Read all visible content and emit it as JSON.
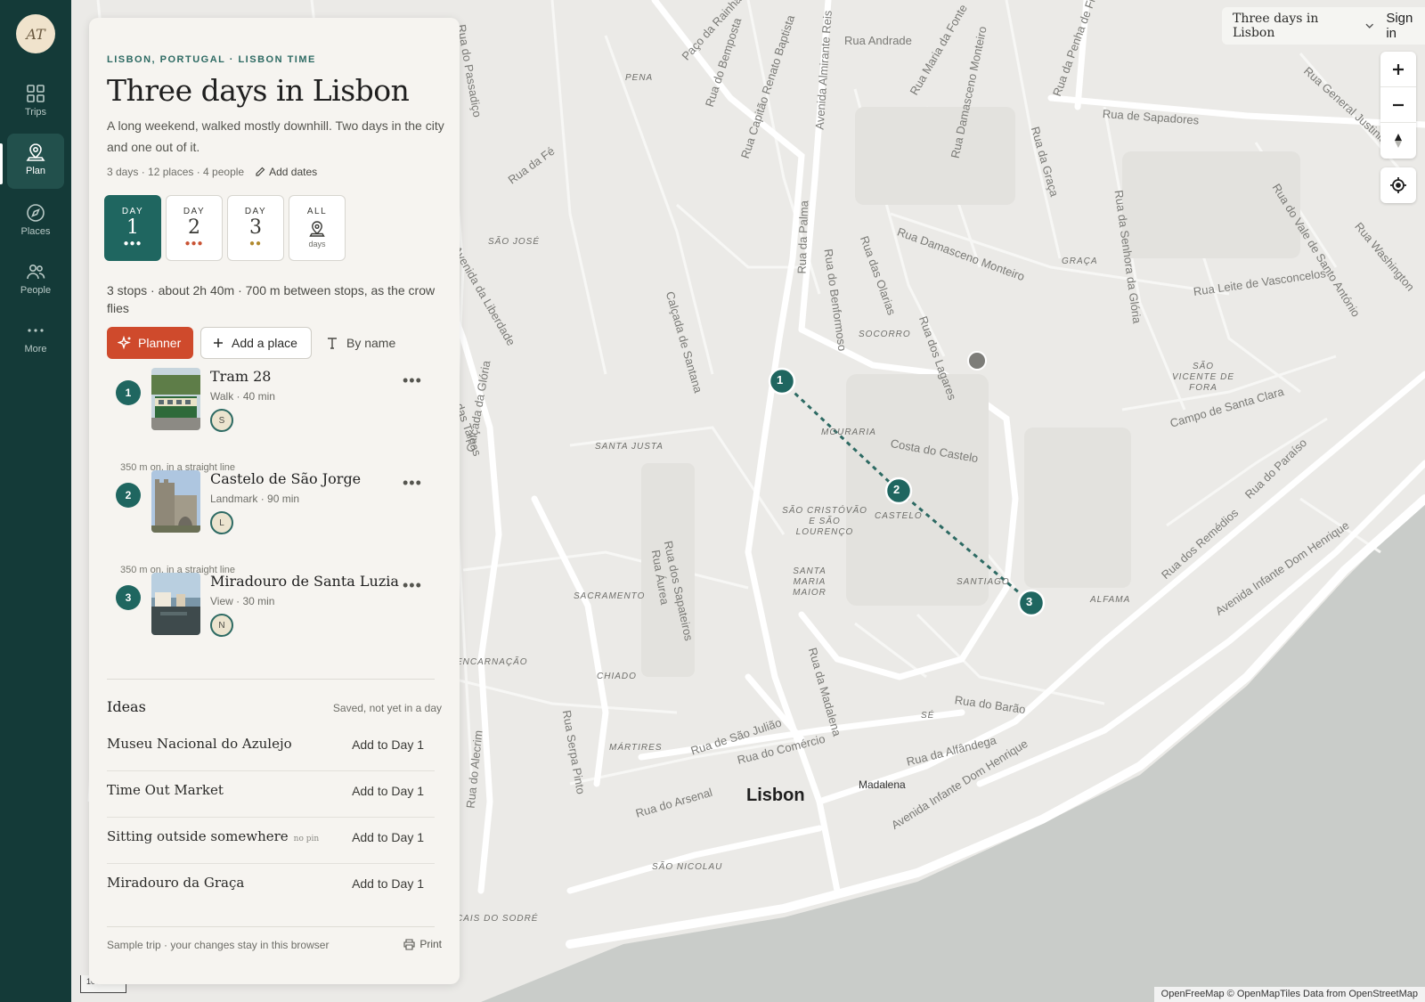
{
  "rail": {
    "avatar": "AT",
    "items": [
      {
        "label": "Trips",
        "icon": "grid-icon"
      },
      {
        "label": "Plan",
        "icon": "map-pin-icon"
      },
      {
        "label": "Places",
        "icon": "compass-icon"
      },
      {
        "label": "People",
        "icon": "people-icon"
      },
      {
        "label": "More",
        "icon": "ellipsis-icon"
      }
    ]
  },
  "trip": {
    "eyebrow": "LISBON, PORTUGAL · LISBON TIME",
    "title": "Three days in Lisbon",
    "description": "A long weekend, walked mostly downhill. Two days in the city and one out of it.",
    "meta": "3 days · 12 places · 4 people",
    "add_dates": "Add dates"
  },
  "days": [
    {
      "caption": "DAY",
      "number": "1",
      "dots": "●●●",
      "dot_color": "#ffffff"
    },
    {
      "caption": "DAY",
      "number": "2",
      "dots": "●●●",
      "dot_color": "#c95334"
    },
    {
      "caption": "DAY",
      "number": "3",
      "dots": "●●",
      "dot_color": "#b0892e"
    },
    {
      "caption": "ALL",
      "sub": "days"
    }
  ],
  "summary": "3 stops · about 2h 40m · 700 m between stops, as the crow flies",
  "actions": {
    "planner": "Planner",
    "add_place": "Add a place",
    "sort": "By name"
  },
  "stops": [
    {
      "index": "1",
      "name": "Tram 28",
      "meta": "Walk · 40 min",
      "person": "S"
    },
    {
      "index": "2",
      "name": "Castelo de São Jorge",
      "meta": "Landmark · 90 min",
      "person": "L"
    },
    {
      "index": "3",
      "name": "Miradouro de Santa Luzia",
      "meta": "View · 30 min",
      "person": "N"
    }
  ],
  "legs": [
    "350 m on, in a straight line",
    "350 m on, in a straight line"
  ],
  "ideas": {
    "title": "Ideas",
    "note": "Saved, not yet in a day",
    "items": [
      {
        "name": "Museu Nacional do Azulejo",
        "tag": "",
        "action": "Add to Day 1"
      },
      {
        "name": "Time Out Market",
        "tag": "",
        "action": "Add to Day 1"
      },
      {
        "name": "Sitting outside somewhere",
        "tag": "no pin",
        "action": "Add to Day 1"
      },
      {
        "name": "Miradouro da Graça",
        "tag": "",
        "action": "Add to Day 1"
      }
    ]
  },
  "footer": {
    "note": "Sample trip · your changes stay in this browser",
    "print": "Print"
  },
  "header": {
    "trip_select": "Three days in Lisbon",
    "sign_in": "Sign in"
  },
  "map": {
    "city": "Lisbon",
    "town": "Madalena",
    "scale": "100 m",
    "attribution": "OpenFreeMap © OpenMapTiles Data from OpenStreetMap",
    "pins": [
      "1",
      "2",
      "3"
    ],
    "streets": [
      "Rua do Passadiço",
      "Paço da Rainha",
      "Rua do Bemposta",
      "Rua Capitão Renato Baptista",
      "Avenida Almirante Reis",
      "Rua Andrade",
      "Rua Maria da Fonte",
      "Rua Damasceno Monteiro",
      "Rua da Penha de França",
      "Rua General Justiniano",
      "Rua de Sapadores",
      "Rua da Graça",
      "Rua da Fé",
      "Rua da Palma",
      "Rua do Benformoso",
      "Rua das Olarias",
      "Rua Damasceno Monteiro",
      "Rua da Senhora da Glória",
      "Rua do Vale de Santo António",
      "Rua Washington",
      "Rua Leite de Vasconcelos",
      "Avenida da Liberdade",
      "Calçada de Santana",
      "Rua dos Lagares",
      "Costa do Castelo",
      "Campo de Santa Clara",
      "Rua do Paraíso",
      "Calçada da Glória",
      "Rua das Taipas",
      "Rua dos Remédios",
      "Avenida Infante Dom Henrique",
      "Rua Áurea",
      "Rua dos Sapateiros",
      "Rua da Madalena",
      "Rua do Barão",
      "Rua Serpa Pinto",
      "Rua de São Julião",
      "Rua do Comércio",
      "Rua da Alfândega",
      "Rua do Arsenal",
      "Avenida Infante Dom Henrique",
      "Rua do Alecrim"
    ],
    "districts": [
      "PENA",
      "SÃO JOSÉ",
      "SOCORRO",
      "GRAÇA",
      "SÃO VICENTE DE FORA",
      "SANTA JUSTA",
      "MOURARIA",
      "SÃO CRISTÓVÃO E SÃO LOURENÇO",
      "CASTELO",
      "SANTA MARIA MAIOR",
      "SANTIAGO",
      "ALFAMA",
      "SACRAMENTO",
      "ENCARNAÇÃO",
      "CHIADO",
      "MÁRTIRES",
      "SÉ",
      "SÃO NICOLAU",
      "CAIS DO SODRÉ"
    ]
  }
}
